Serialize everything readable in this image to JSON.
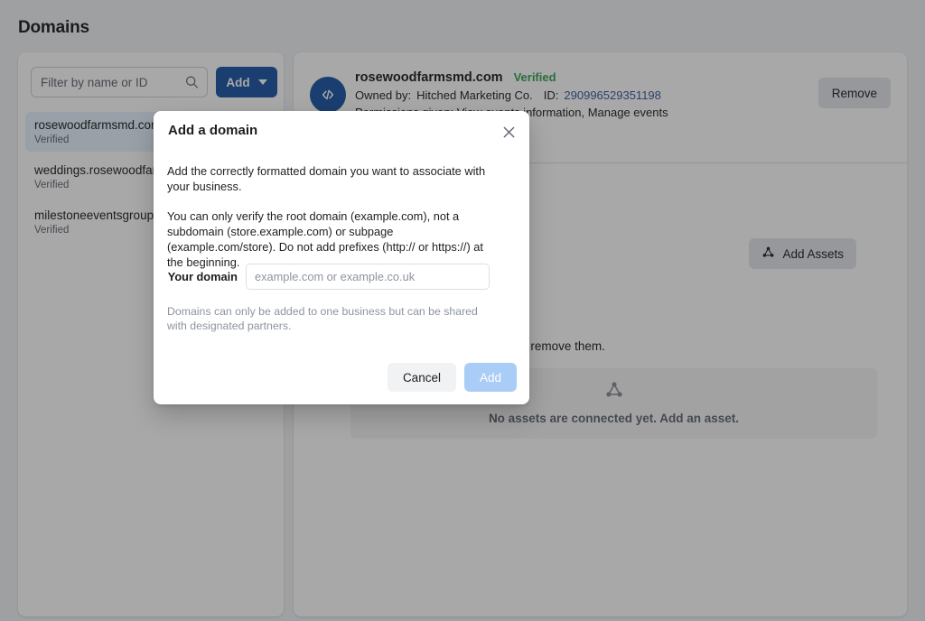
{
  "page": {
    "title": "Domains"
  },
  "sidebar": {
    "filter": {
      "placeholder": "Filter by name or ID",
      "value": "",
      "icon": "search-icon"
    },
    "add_button": {
      "label": "Add",
      "icon": "chevron-down-icon",
      "color": "#1b55a4"
    },
    "items": [
      {
        "name": "rosewoodfarmsmd.com",
        "status": "Verified",
        "selected": true
      },
      {
        "name": "weddings.rosewoodfarmsmd.com",
        "status": "Verified",
        "selected": false
      },
      {
        "name": "milestoneeventsgroup.com",
        "status": "Verified",
        "selected": false
      }
    ]
  },
  "detail": {
    "avatar_icon": "code-icon",
    "domain": "rosewoodfarmsmd.com",
    "verified_label": "Verified",
    "verified_color": "#31a24c",
    "owned_by_label": "Owned by:",
    "owned_by_value": "Hitched Marketing Co.",
    "id_label": "ID:",
    "id_value": "290996529351198",
    "id_color": "#385898",
    "permissions": "Permissions given: View events information, Manage events",
    "remove_button": "Remove",
    "add_assets_button": {
      "label": "Add Assets",
      "icon": "assets-node-icon"
    },
    "assets_description": "These are the connected assets. Add or remove them.",
    "empty_state": {
      "icon": "assets-node-icon",
      "text": "No assets are connected yet. Add an asset."
    }
  },
  "modal": {
    "title": "Add a domain",
    "close_icon": "close-icon",
    "paragraph_1": "Add the correctly formatted domain you want to associate with your business.",
    "paragraph_2": "You can only verify the root domain (example.com), not a subdomain (store.example.com) or subpage (example.com/store). Do not add prefixes (http:// or https://) at the beginning.",
    "field_label": "Your domain",
    "field_placeholder": "example.com or example.co.uk",
    "field_value": "",
    "note": "Domains can only be added to one business but can be shared with designated partners.",
    "cancel_button": "Cancel",
    "add_button": "Add",
    "add_button_color": "#aacdf7"
  }
}
